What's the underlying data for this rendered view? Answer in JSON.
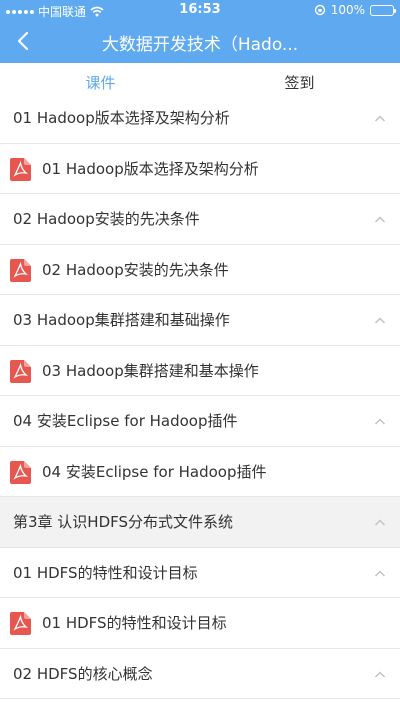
{
  "status_bar": {
    "carrier": "中国联通",
    "time": "16:53",
    "battery_percent": "100%"
  },
  "nav": {
    "title": "大数据开发技术（Hado..."
  },
  "tabs": [
    {
      "label": "课件",
      "active": true
    },
    {
      "label": "签到",
      "active": false
    }
  ],
  "rows": [
    {
      "type": "section",
      "text": "01 Hadoop版本选择及架构分析",
      "icon": "chevron-up-icon"
    },
    {
      "type": "file",
      "text": "01 Hadoop版本选择及架构分析",
      "icon": "pdf-icon"
    },
    {
      "type": "section",
      "text": "02 Hadoop安装的先决条件",
      "icon": "chevron-up-icon"
    },
    {
      "type": "file",
      "text": "02 Hadoop安装的先决条件",
      "icon": "pdf-icon"
    },
    {
      "type": "section",
      "text": "03 Hadoop集群搭建和基础操作",
      "icon": "chevron-up-icon"
    },
    {
      "type": "file",
      "text": "03 Hadoop集群搭建和基本操作",
      "icon": "pdf-icon"
    },
    {
      "type": "section",
      "text": "04 安装Eclipse for Hadoop插件",
      "icon": "chevron-up-icon"
    },
    {
      "type": "file",
      "text": "04 安装Eclipse for Hadoop插件",
      "icon": "pdf-icon"
    },
    {
      "type": "chapter",
      "text": "第3章 认识HDFS分布式文件系统",
      "icon": "chevron-up-icon"
    },
    {
      "type": "section",
      "text": "01 HDFS的特性和设计目标",
      "icon": "chevron-up-icon"
    },
    {
      "type": "file",
      "text": "01 HDFS的特性和设计目标",
      "icon": "pdf-icon"
    },
    {
      "type": "section",
      "text": "02 HDFS的核心概念",
      "icon": "chevron-up-icon"
    }
  ],
  "colors": {
    "accent": "#5ea9f0",
    "pdf_red": "#e8574f",
    "chapter_bg": "#f2f2f2"
  }
}
